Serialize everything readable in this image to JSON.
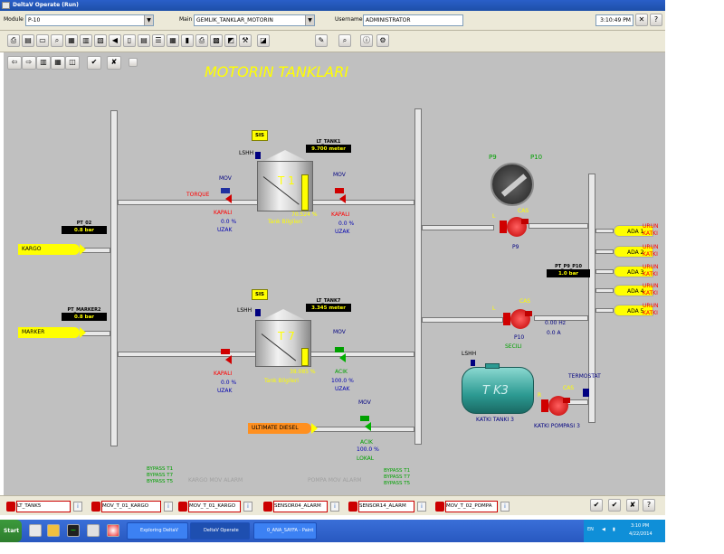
{
  "window": {
    "title": "DeltaV Operate (Run)"
  },
  "topbar": {
    "module_label": "Module",
    "module_value": "P-10",
    "main_label": "Main",
    "main_value": "GEMLIK_TANKLAR_MOTORIN",
    "user_label": "Username",
    "user_value": "ADMINISTRATOR",
    "time": "3:10:49 PM"
  },
  "display": {
    "title": "MOTORIN TANKLARI",
    "lines": {
      "kargo": "KARGO",
      "marker": "MARKER",
      "ultimate": "ULTIMATE DIESEL"
    },
    "pt02": {
      "name": "PT_02",
      "value": "0.8 bar"
    },
    "pt_marker": {
      "name": "PT_MARKER2",
      "value": "0.8 bar"
    },
    "pt_p9_p10": {
      "name": "PT_P9_P10",
      "value": "1.0 bar"
    },
    "tank1": {
      "sis": "SIS",
      "lshh": "LSHH",
      "tag_name": "LT_TANK1",
      "tag_value": "9.700 meter",
      "label": "T 1",
      "percent": "70.524 %",
      "info": "Tank Bilgileri",
      "mov_left": "MOV",
      "mov_left_state": "KAPALI",
      "mov_left_pct": "0.0  %",
      "mov_left_mode": "UZAK",
      "torque": "TORQUE",
      "mov_right": "MOV",
      "mov_right_state": "KAPALI",
      "mov_right_pct": "0.0  %",
      "mov_right_mode": "UZAK"
    },
    "tank7": {
      "sis": "SIS",
      "lshh": "LSHH",
      "tag_name": "LT_TANK7",
      "tag_value": "3.345 meter",
      "label": "T 7",
      "percent": "38.085 %",
      "info": "Tank Bilgileri",
      "mov_left": "MOV",
      "mov_left_state": "KAPALI",
      "mov_left_pct": "0.0  %",
      "mov_left_mode": "UZAK",
      "mov_right": "MOV",
      "mov_right_state": "ACIK",
      "mov_right_pct": "100.0  %",
      "mov_right_mode": "UZAK"
    },
    "ultimate_mov": {
      "label": "MOV",
      "state": "ACIK",
      "pct": "100.0  %",
      "mode": "LOKAL"
    },
    "rotary": {
      "p9": "P9",
      "p10": "P10"
    },
    "pump_p9": {
      "l": "L",
      "cas": "CAS",
      "name": "P9"
    },
    "pump_p10": {
      "l": "L",
      "cas": "CAS",
      "name": "P10",
      "state": "SECILI",
      "hz": "0.00  Hz",
      "amp": "0.0   A"
    },
    "tk3": {
      "lshh": "LSHH",
      "label": "T K3",
      "name": "KATKI TANKI 3"
    },
    "katki_pump": {
      "r": "R",
      "cas": "CAS",
      "name": "KATKI POMPASI 3",
      "thermostat": "TERMOSTAT"
    },
    "ada": [
      {
        "label": "ADA 1",
        "right": "URUN\nKATKI"
      },
      {
        "label": "ADA 2",
        "right": "URUN\nKATKI"
      },
      {
        "label": "ADA 3",
        "right": "URUN\nKATKI"
      },
      {
        "label": "ADA 4",
        "right": "URUN\nKATKI"
      },
      {
        "label": "ADA 5",
        "right": "URUN\nKATKI"
      }
    ],
    "bypass_left": "BYPASS T1\nBYPASS T7\nBYPASS T5",
    "bypass_right": "BYPASS T1\nBYPASS T7\nBYPASS T5",
    "kargo_alarm": "KARGO MOV ALARM",
    "pompa_alarm": "POMPA MOV ALARM"
  },
  "alarms": [
    "LT_TANK5",
    "MOV_T_01_KARGO",
    "MOV_T_01_KARGO",
    "SENSOR04_ALARM",
    "SENSOR14_ALARM",
    "MOV_T_02_POMPA"
  ],
  "taskbar": {
    "start": "Start",
    "buttons": [
      "Exploring DeltaV",
      "DeltaV Operate (R...",
      "0_ANA_SAYFA - Paint"
    ],
    "lang": "EN",
    "clock_time": "3:10 PM",
    "clock_date": "4/22/2014"
  },
  "colors": {
    "titlebar": "#2a5fc8",
    "main_bg": "#c0c0c0",
    "accent_yellow": "#ffff00",
    "alarm_red": "#ff0000"
  }
}
